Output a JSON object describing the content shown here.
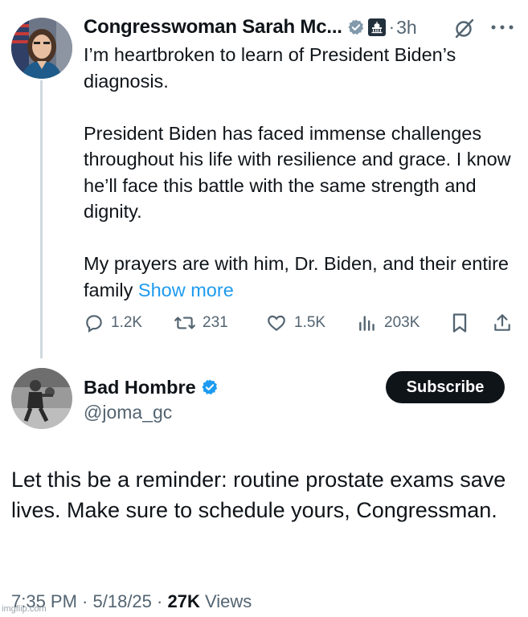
{
  "original_tweet": {
    "author_name": "Congresswoman Sarah Mc...",
    "time": "3h",
    "dot": "·",
    "paragraphs": [
      "I’m heartbroken to learn of President Biden’s diagnosis.",
      "President Biden has faced immense challenges throughout his life with resilience and grace. I know he’ll face this battle with the same strength and dignity.",
      "My prayers are with him, Dr. Biden, and their entire family"
    ],
    "show_more": "Show more",
    "actions": {
      "replies": "1.2K",
      "reposts": "231",
      "likes": "1.5K",
      "views": "203K"
    }
  },
  "reply_tweet": {
    "author_name": "Bad Hombre",
    "handle": "@joma_gc",
    "subscribe_label": "Subscribe",
    "text": "Let this be a reminder: routine prostate exams save lives. Make sure to schedule yours, Congressman.",
    "time": "7:35 PM",
    "date": "5/18/25",
    "views_count": "27K",
    "views_label": "Views"
  },
  "watermark": "imgflip.com",
  "icons": {
    "verified": "verified-badge-icon",
    "government": "capitol-icon",
    "grok": "grok-icon",
    "more": "more-icon",
    "reply": "reply-icon",
    "repost": "repost-icon",
    "like": "heart-icon",
    "views": "views-icon",
    "bookmark": "bookmark-icon",
    "share": "share-icon"
  },
  "colors": {
    "text": "#0f1419",
    "secondary": "#536471",
    "link": "#1d9bf0",
    "verified_original": "#829aab",
    "verified_reply": "#1d9bf0",
    "thread_line": "#cfd9de"
  }
}
